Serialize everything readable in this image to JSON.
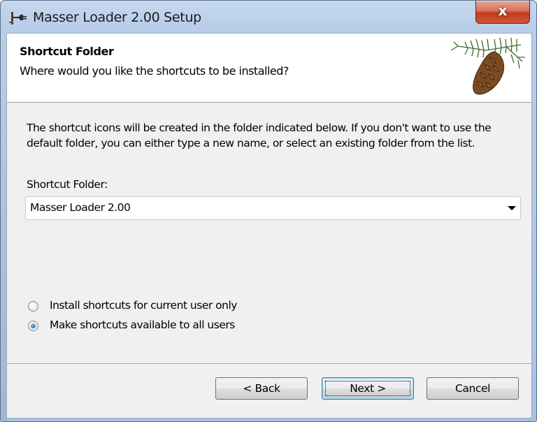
{
  "window": {
    "title": "Masser Loader 2.00 Setup",
    "close_label": "x",
    "app_icon": "setup-plug-icon"
  },
  "header": {
    "title": "Shortcut Folder",
    "subtitle": "Where would you like the shortcuts to be installed?",
    "image": "pine-cone-icon"
  },
  "body": {
    "description": "The shortcut icons will be created in the folder indicated below. If you don't want to use the default folder, you can either type a new name, or select an existing folder from the list.",
    "folder_label": "Shortcut Folder:",
    "folder_value": "Masser Loader 2.00"
  },
  "options": [
    {
      "label": "Install shortcuts for current user only",
      "checked": false
    },
    {
      "label": "Make shortcuts available to all users",
      "checked": true
    }
  ],
  "buttons": {
    "back": "< Back",
    "next": "Next >",
    "cancel": "Cancel"
  },
  "colors": {
    "title_bar": "#b7cde8",
    "close_button": "#c23a1e",
    "radio_selected": "#1f5fa8"
  }
}
